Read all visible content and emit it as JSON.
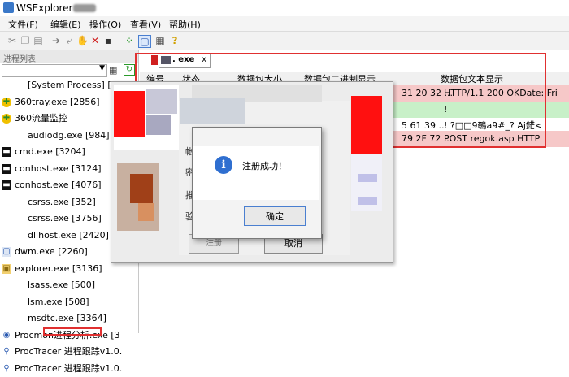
{
  "window": {
    "title": "WSExplorer - "
  },
  "menu": [
    "文件(F)",
    "编辑(E)",
    "操作(O)",
    "查看(V)",
    "帮助(H)"
  ],
  "left_panel": {
    "header": "进程列表",
    "processes": [
      {
        "name": "[System Process] [0]",
        "icon": "none"
      },
      {
        "name": "360tray.exe [2856]",
        "icon": "360-icon"
      },
      {
        "name": "360流量监控",
        "icon": "360-icon"
      },
      {
        "name": "audiodg.exe [984]",
        "icon": "none"
      },
      {
        "name": "cmd.exe [3204]",
        "icon": "console-icon"
      },
      {
        "name": "conhost.exe [3124]",
        "icon": "console-icon"
      },
      {
        "name": "conhost.exe [4076]",
        "icon": "console-icon"
      },
      {
        "name": "csrss.exe [352]",
        "icon": "none"
      },
      {
        "name": "csrss.exe [3756]",
        "icon": "none"
      },
      {
        "name": "dllhost.exe [2420]",
        "icon": "none"
      },
      {
        "name": "dwm.exe [2260]",
        "icon": "window-icon"
      },
      {
        "name": "explorer.exe [3136]",
        "icon": "folder-icon"
      },
      {
        "name": "lsass.exe [500]",
        "icon": "none"
      },
      {
        "name": "lsm.exe [508]",
        "icon": "none"
      },
      {
        "name": "msdtc.exe [3364]",
        "icon": "none"
      },
      {
        "name": "Procmon进程分析.exe [3",
        "icon": "procmon-icon"
      },
      {
        "name": "ProcTracer 进程跟踪v1.0.",
        "icon": "magnifier-icon"
      },
      {
        "name": "ProcTracer 进程跟踪v1.0.",
        "icon": "magnifier-icon"
      }
    ]
  },
  "tab": {
    "label": ". exe",
    "close": "x"
  },
  "table": {
    "headers": [
      "编号",
      "状态",
      "数据包大小",
      "数据包二进制显示",
      "数据包文本显示"
    ],
    "rows": [
      {
        "hex": "31 20 32 ...",
        "text": "HTTP/1.1 200 OKDate: Fri"
      },
      {
        "hex": "",
        "text": "!"
      },
      {
        "hex": "5 61 39 ...",
        "text": "!  ?□□9鵪a9#_?        Aj鋩<"
      },
      {
        "hex": "79 2F 72 ...",
        "text": "POST          regok.asp HTTP"
      }
    ]
  },
  "background_dialog": {
    "labels": [
      "帐",
      "密",
      "推",
      "验"
    ],
    "left_button": "注册",
    "right_button": "取消"
  },
  "message_box": {
    "text": "注册成功！",
    "ok_button": "确定"
  },
  "colors": {
    "highlight_red": "#e03030",
    "row_pink": "#f6c8c8",
    "row_green": "#c8f0c8",
    "accent_blue": "#2f6fd0"
  }
}
